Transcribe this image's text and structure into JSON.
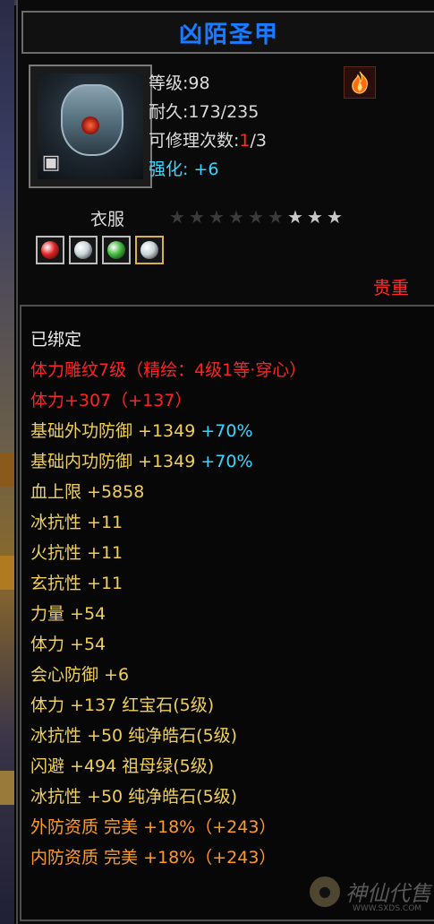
{
  "item": {
    "name": "凶陌圣甲",
    "icon": "armor-mask-icon",
    "bound_icon": "lock-icon",
    "enhance_icon": "fire-icon",
    "level_label": "等级:98",
    "durability_label": "耐久:173/235",
    "repair_prefix": "可修理次数:",
    "repair_current": "1",
    "repair_total": "/3",
    "enhance_label": "强化: +6",
    "type": "衣服",
    "stars_total": 9,
    "stars_filled": 6,
    "rarity": "贵重"
  },
  "gems": [
    {
      "name": "red-gem-icon",
      "color": "#e02020"
    },
    {
      "name": "white-gem-icon",
      "color": "#c8d4d8"
    },
    {
      "name": "green-gem-icon",
      "color": "#3fb83a"
    },
    {
      "name": "white-gem-icon",
      "color": "#c8d4d8"
    }
  ],
  "stats": [
    {
      "text": "已绑定",
      "color": "white"
    },
    {
      "text": "体力雕纹7级（精绘：4级1等·穿心）",
      "color": "red"
    },
    {
      "text": "体力+307（+137）",
      "color": "red"
    },
    {
      "text": "基础外功防御 +1349",
      "extra": "+70%",
      "color": "gold"
    },
    {
      "text": "基础内功防御 +1349",
      "extra": "+70%",
      "color": "gold"
    },
    {
      "text": "血上限 +5858",
      "color": "gold"
    },
    {
      "text": "冰抗性 +11",
      "color": "gold"
    },
    {
      "text": "火抗性 +11",
      "color": "gold"
    },
    {
      "text": "玄抗性 +11",
      "color": "gold"
    },
    {
      "text": "力量 +54",
      "color": "gold"
    },
    {
      "text": "体力 +54",
      "color": "gold"
    },
    {
      "text": "会心防御 +6",
      "color": "gold"
    },
    {
      "text": "体力 +137 红宝石(5级)",
      "color": "gold"
    },
    {
      "text": "冰抗性 +50 纯净皓石(5级)",
      "color": "gold"
    },
    {
      "text": "闪避 +494 祖母绿(5级)",
      "color": "gold"
    },
    {
      "text": "冰抗性 +50 纯净皓石(5级)",
      "color": "gold"
    },
    {
      "text": "外防资质  完美 +18%（+243）",
      "color": "orange"
    },
    {
      "text": "内防资质  完美 +18%（+243）",
      "color": "orange"
    }
  ],
  "watermark": {
    "text": "神仙代售",
    "url": "WWW.SXDS.COM",
    "logo": "mascot-logo"
  },
  "colors": {
    "title": "#1a7bff",
    "red": "#ff2323",
    "gold": "#f0cf5a",
    "orange": "#ff9a2a",
    "cyan": "#39d6ff"
  }
}
